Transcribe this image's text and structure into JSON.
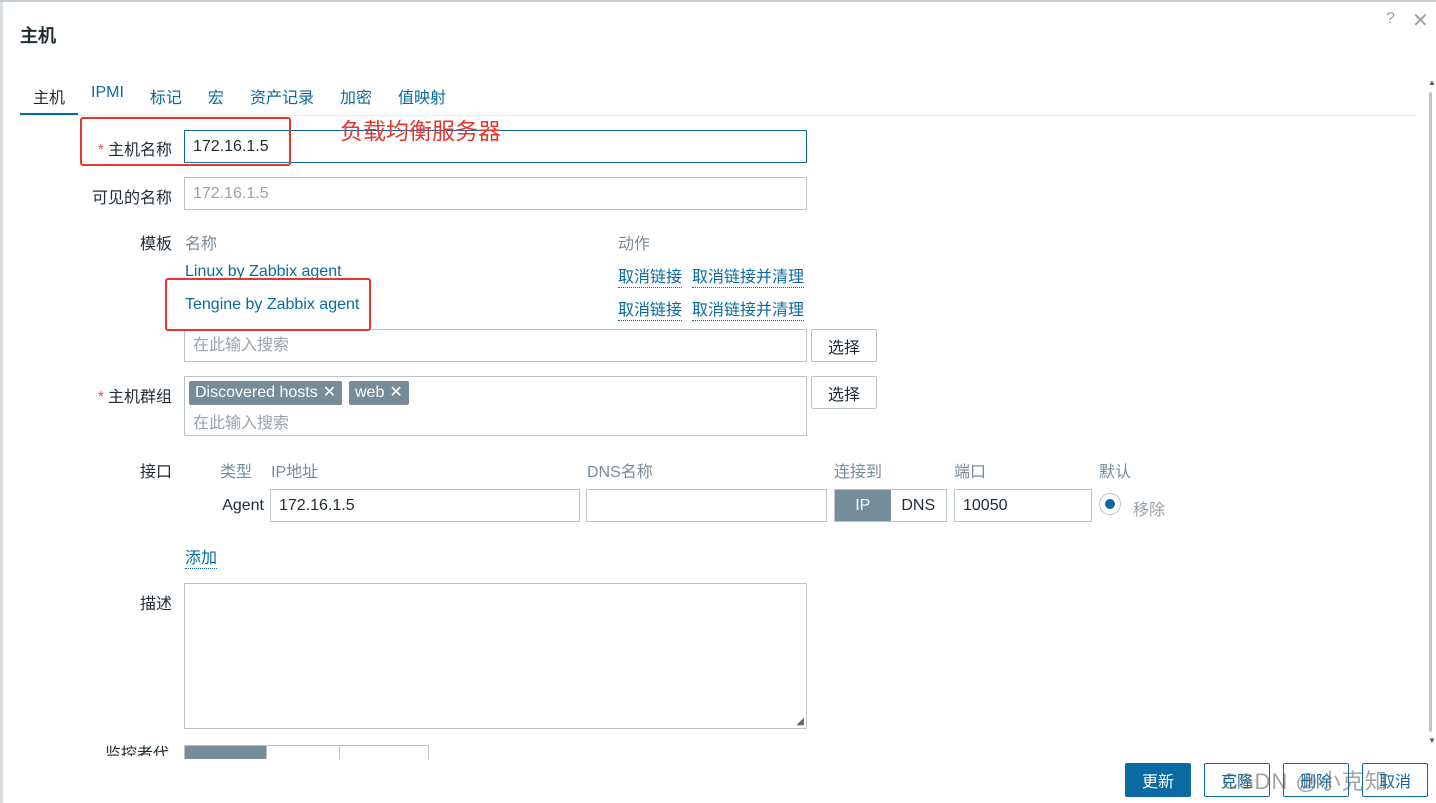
{
  "dialog": {
    "title": "主机",
    "help": "?",
    "close": "✕"
  },
  "tabs": [
    "主机",
    "IPMI",
    "标记",
    "宏",
    "资产记录",
    "加密",
    "值映射"
  ],
  "form": {
    "host_name": {
      "label": "主机名称",
      "value": "172.16.1.5"
    },
    "visible_name": {
      "label": "可见的名称",
      "placeholder": "172.16.1.5"
    },
    "templates": {
      "label": "模板",
      "col_name": "名称",
      "col_action": "动作",
      "items": [
        {
          "name": "Linux by Zabbix agent",
          "unlink": "取消链接",
          "unlink_clear": "取消链接并清理"
        },
        {
          "name": "Tengine by Zabbix agent",
          "unlink": "取消链接",
          "unlink_clear": "取消链接并清理"
        }
      ],
      "search_placeholder": "在此输入搜索",
      "select_button": "选择"
    },
    "host_groups": {
      "label": "主机群组",
      "chips": [
        "Discovered hosts",
        "web"
      ],
      "search_placeholder": "在此输入搜索",
      "select_button": "选择"
    },
    "interfaces": {
      "label": "接口",
      "headers": {
        "type": "类型",
        "ip": "IP地址",
        "dns": "DNS名称",
        "connect": "连接到",
        "port": "端口",
        "default": "默认"
      },
      "row": {
        "type": "Agent",
        "ip": "172.16.1.5",
        "dns": "",
        "connect_ip": "IP",
        "connect_dns": "DNS",
        "port": "10050",
        "remove": "移除"
      },
      "add": "添加"
    },
    "description": {
      "label": "描述",
      "value": ""
    },
    "monitored_by_label": "监控者代理"
  },
  "footer": {
    "update": "更新",
    "clone": "克隆",
    "delete": "删除",
    "cancel": "取消"
  },
  "annotation": {
    "text": "负载均衡服务器"
  },
  "watermark": "CSDN @小克知",
  "colors": {
    "link": "#0a6aa1",
    "chip": "#768d99",
    "required": "#e45959",
    "annotation": "#e8352e"
  }
}
